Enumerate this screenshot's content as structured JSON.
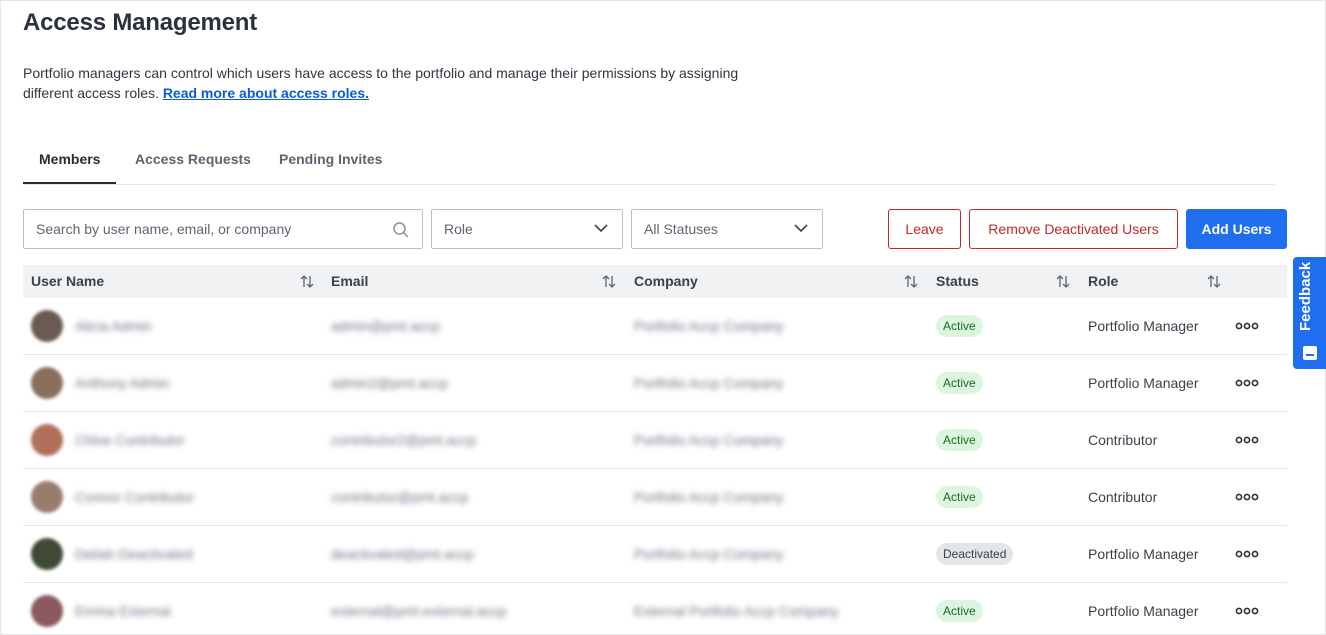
{
  "page": {
    "title": "Access Management",
    "description": "Portfolio managers can control which users have access to the portfolio and manage their permissions by assigning different access roles.",
    "link_text": "Read more about access roles."
  },
  "tabs": [
    {
      "label": "Members",
      "active": true
    },
    {
      "label": "Access Requests",
      "active": false
    },
    {
      "label": "Pending Invites",
      "active": false
    }
  ],
  "filters": {
    "search_placeholder": "Search by user name, email, or company",
    "role_value": "Role",
    "status_value": "All Statuses"
  },
  "actions": {
    "leave": "Leave",
    "remove_deactivated": "Remove Deactivated Users",
    "add_users": "Add Users"
  },
  "table": {
    "columns": [
      "User Name",
      "Email",
      "Company",
      "Status",
      "Role"
    ],
    "rows": [
      {
        "name": "Alicia Admin",
        "email": "admin@pmt.accp",
        "company": "Portfolio Accp Company",
        "status": "Active",
        "role": "Portfolio Manager",
        "avatar_color": "#6b5a52"
      },
      {
        "name": "Anthony Admin",
        "email": "admin2@pmt.accp",
        "company": "Portfolio Accp Company",
        "status": "Active",
        "role": "Portfolio Manager",
        "avatar_color": "#8a6f5c"
      },
      {
        "name": "Chloe Contributor",
        "email": "contributor2@pmt.accp",
        "company": "Portfolio Accp Company",
        "status": "Active",
        "role": "Contributor",
        "avatar_color": "#b0705a"
      },
      {
        "name": "Connor Contributor",
        "email": "contributor@pmt.accp",
        "company": "Portfolio Accp Company",
        "status": "Active",
        "role": "Contributor",
        "avatar_color": "#9a7c6c"
      },
      {
        "name": "Deliah Deactivated",
        "email": "deactivated@pmt.accp",
        "company": "Portfolio Accp Company",
        "status": "Deactivated",
        "role": "Portfolio Manager",
        "avatar_color": "#3f4a34"
      },
      {
        "name": "Emma External",
        "email": "external@pmt-external.accp",
        "company": "External Portfolio Accp Company",
        "status": "Active",
        "role": "Portfolio Manager",
        "avatar_color": "#8a5a60"
      }
    ]
  },
  "feedback": {
    "label": "Feedback"
  },
  "colors": {
    "primary": "#1f6ef0",
    "danger": "#c1282d",
    "active_bg": "#dcf5de"
  }
}
